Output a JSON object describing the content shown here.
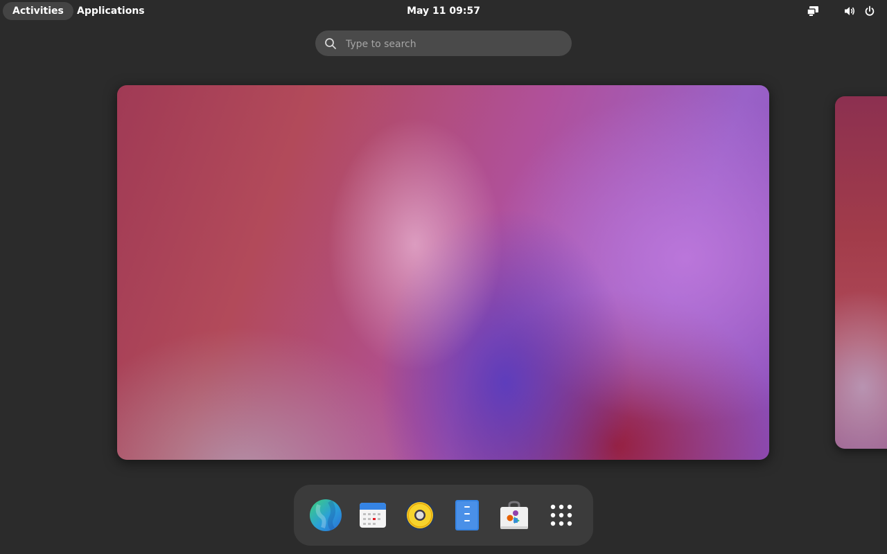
{
  "topbar": {
    "activities_label": "Activities",
    "applications_label": "Applications",
    "clock": "May 11  09:57",
    "tray_icons": [
      "display-icon",
      "volume-icon",
      "power-icon"
    ]
  },
  "search": {
    "placeholder": "Type to search",
    "value": ""
  },
  "workspaces": {
    "current": "workspace-1",
    "items": [
      "workspace-1",
      "workspace-2"
    ]
  },
  "dock": {
    "items": [
      {
        "name": "web-browser",
        "icon": "globe-icon"
      },
      {
        "name": "calendar",
        "icon": "calendar-icon"
      },
      {
        "name": "music-player",
        "icon": "speaker-icon"
      },
      {
        "name": "text-editor",
        "icon": "notepad-icon"
      },
      {
        "name": "software-center",
        "icon": "shopping-bag-icon"
      },
      {
        "name": "show-applications",
        "icon": "app-grid-icon"
      }
    ]
  },
  "colors": {
    "panel_background": "#2b2b2b",
    "search_background": "#4a4a4a",
    "dock_background": "#3b3b3b",
    "activities_highlight": "#444444"
  }
}
